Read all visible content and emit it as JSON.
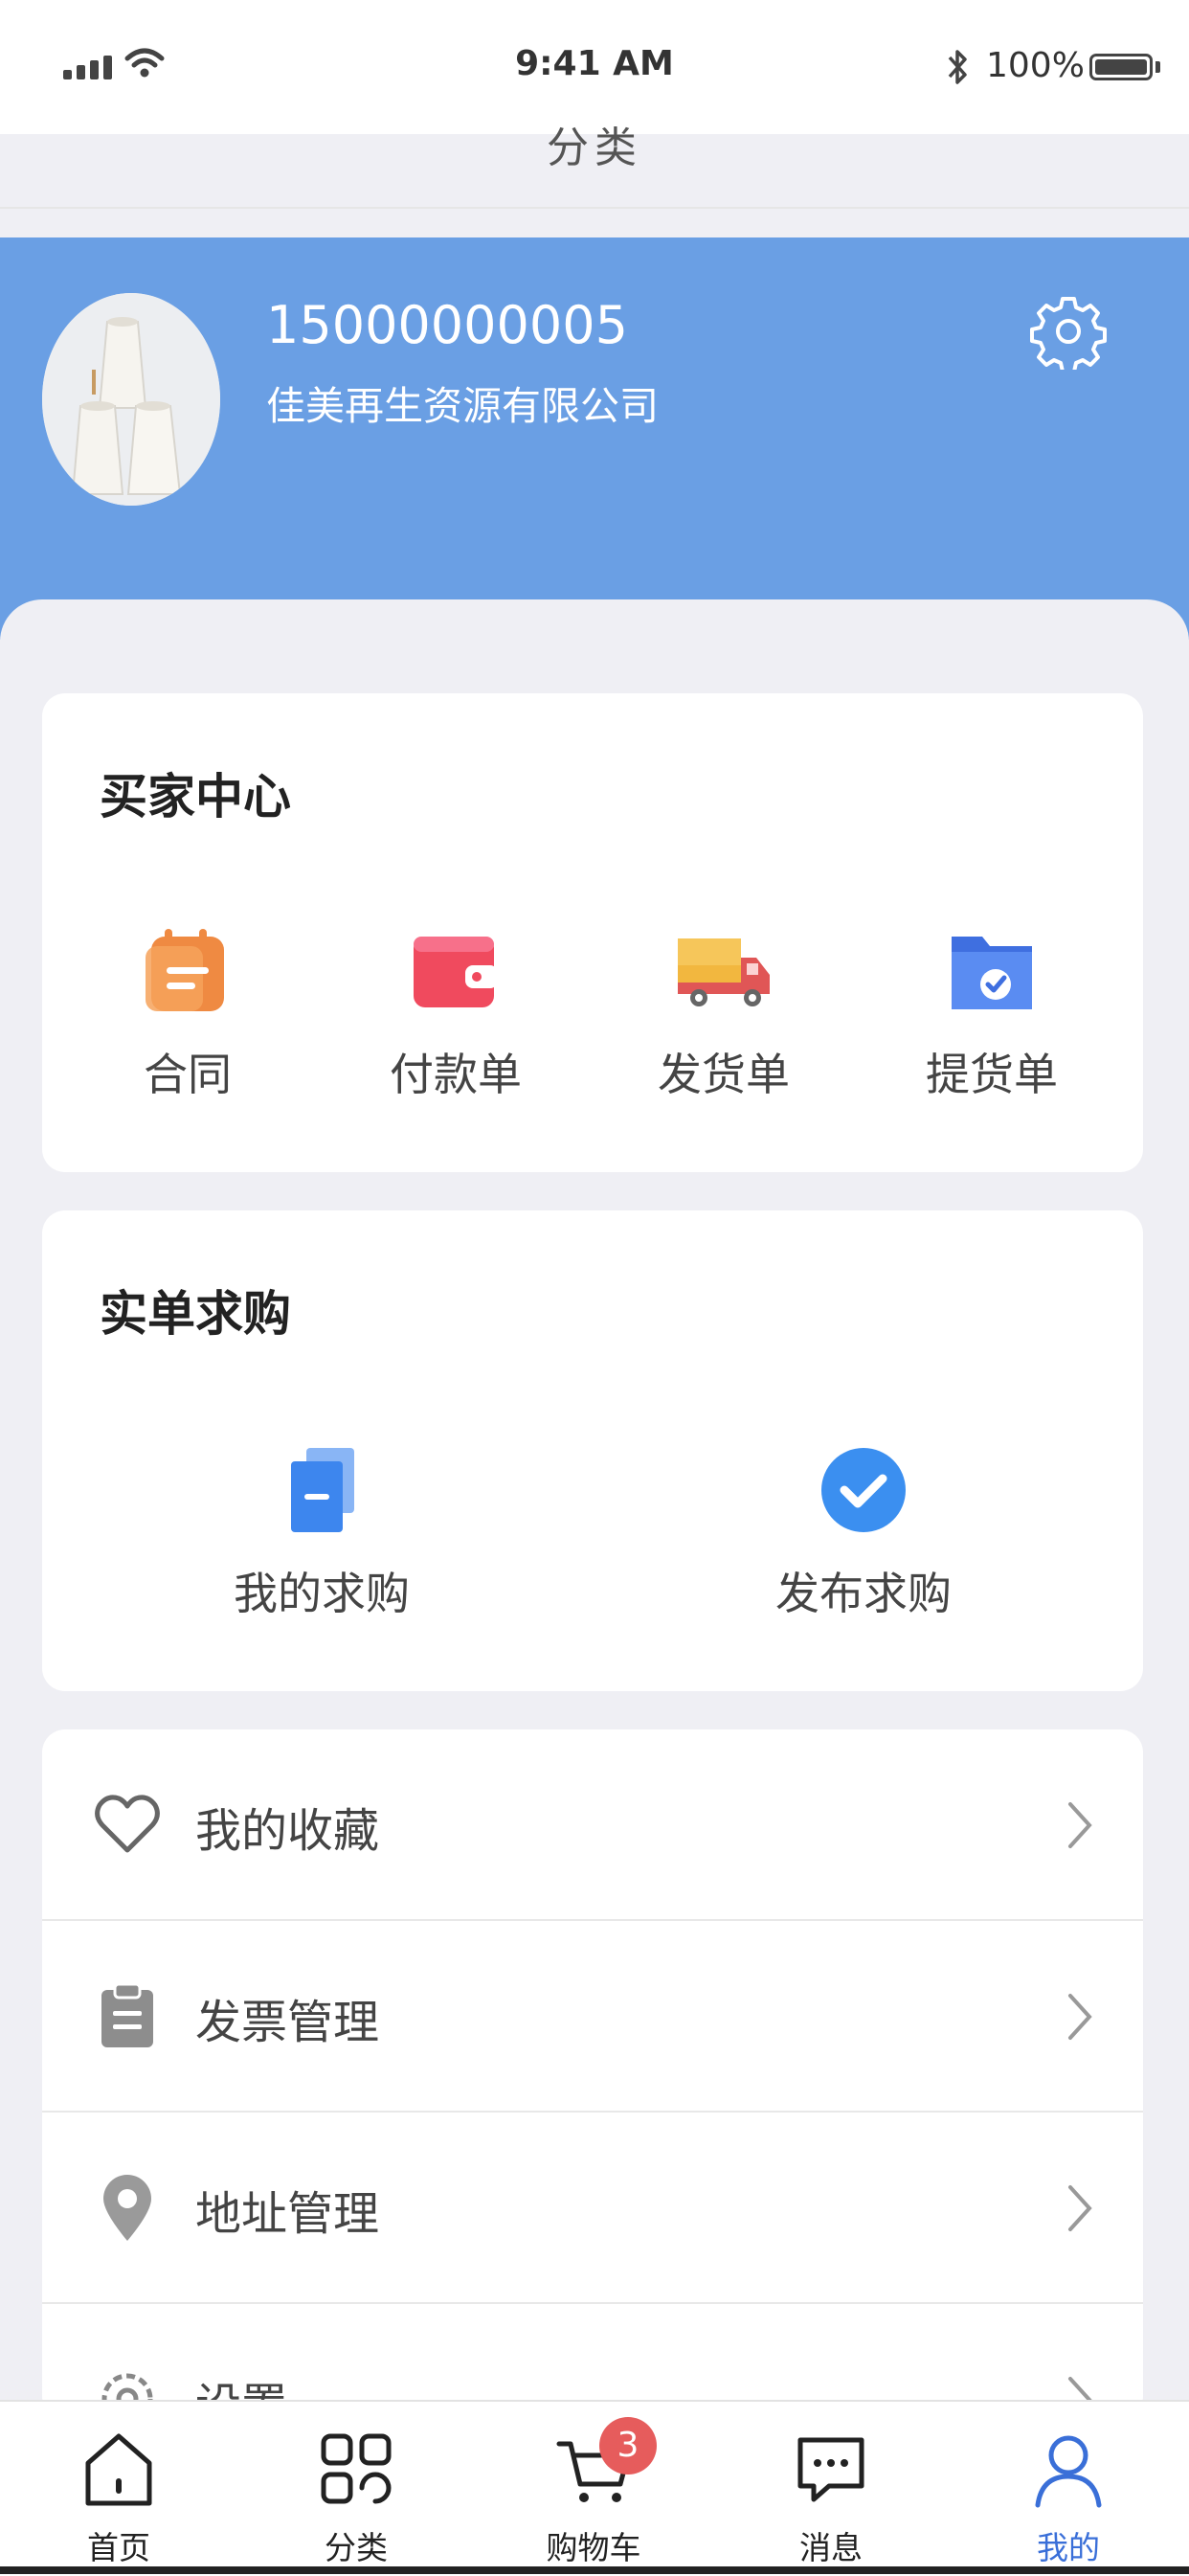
{
  "status_bar": {
    "time": "9:41 AM",
    "battery": "100%"
  },
  "nav": {
    "title": "分类"
  },
  "profile": {
    "phone": "15000000005",
    "company": "佳美再生资源有限公司"
  },
  "buyer_center": {
    "title": "买家中心",
    "items": [
      {
        "label": "合同",
        "icon": "calendar-contract-icon"
      },
      {
        "label": "付款单",
        "icon": "wallet-icon"
      },
      {
        "label": "发货单",
        "icon": "truck-icon"
      },
      {
        "label": "提货单",
        "icon": "folder-check-icon"
      }
    ]
  },
  "purchase": {
    "title": "实单求购",
    "items": [
      {
        "label": "我的求购",
        "icon": "document-stack-icon"
      },
      {
        "label": "发布求购",
        "icon": "check-circle-icon"
      }
    ]
  },
  "menu": [
    {
      "label": "我的收藏",
      "icon": "heart-icon"
    },
    {
      "label": "发票管理",
      "icon": "clipboard-icon"
    },
    {
      "label": "地址管理",
      "icon": "location-pin-icon"
    },
    {
      "label": "设置",
      "icon": "gear-icon"
    }
  ],
  "tabbar": {
    "cart_badge": "3",
    "tabs": [
      {
        "label": "首页",
        "icon": "home-icon"
      },
      {
        "label": "分类",
        "icon": "category-grid-icon"
      },
      {
        "label": "购物车",
        "icon": "cart-icon"
      },
      {
        "label": "消息",
        "icon": "message-icon"
      },
      {
        "label": "我的",
        "icon": "user-icon"
      }
    ],
    "active": "我的"
  },
  "colors": {
    "header_blue": "#6a9fe4",
    "active_tab": "#3a6fd8",
    "badge_red": "#e65c5c"
  }
}
